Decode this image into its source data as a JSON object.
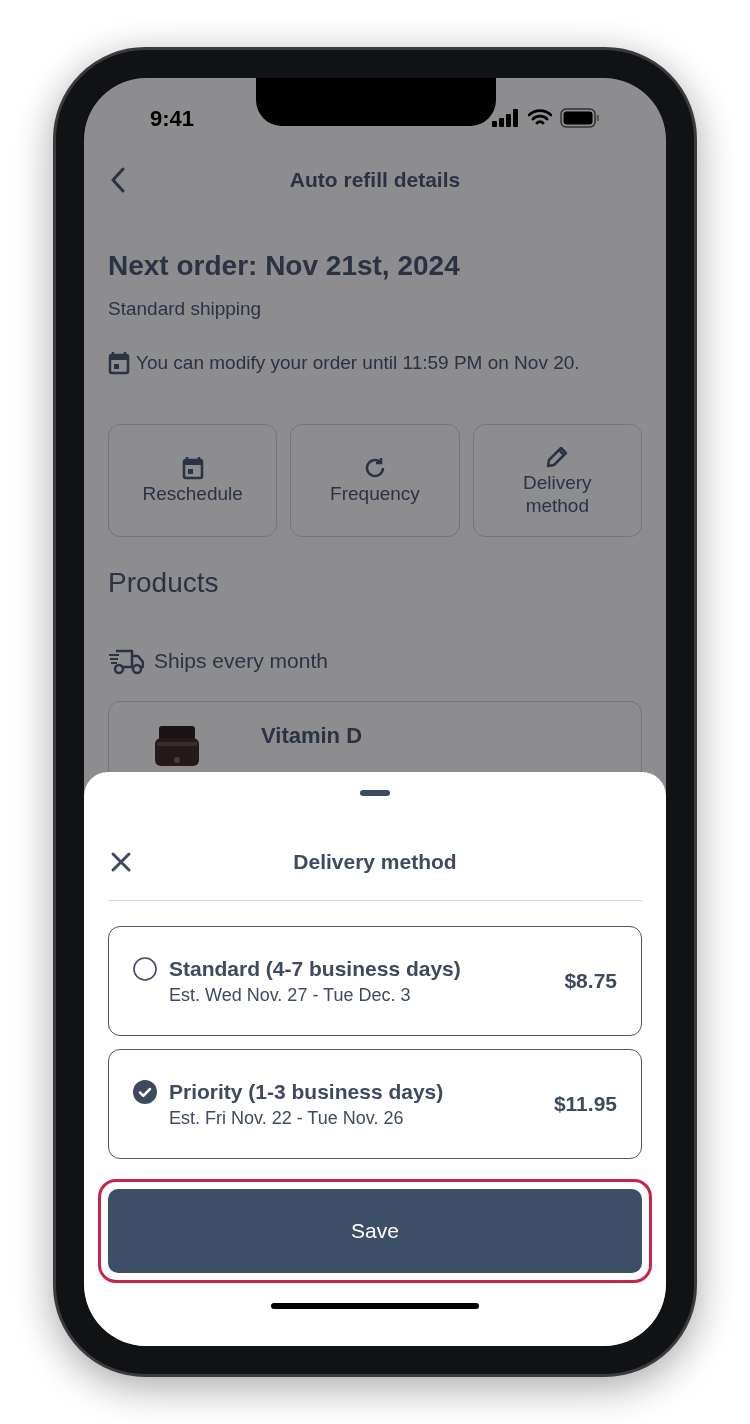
{
  "status_bar": {
    "time": "9:41"
  },
  "header": {
    "title": "Auto refill details"
  },
  "order": {
    "title": "Next order: Nov 21st, 2024",
    "shipping": "Standard shipping",
    "notice": "You can modify your order until 11:59 PM on Nov 20."
  },
  "actions": [
    {
      "label": "Reschedule",
      "kind": "calendar"
    },
    {
      "label": "Frequency",
      "kind": "refresh"
    },
    {
      "label": "Delivery method",
      "kind": "pencil"
    }
  ],
  "products": {
    "heading": "Products",
    "schedule": "Ships every month",
    "items": [
      {
        "name": "Vitamin D",
        "kind": "picture"
      }
    ]
  },
  "sheet": {
    "title": "Delivery method",
    "options": [
      {
        "label": "Standard (4-7 business days)",
        "eta": "Est. Wed Nov. 27 - Tue Dec. 3",
        "price": "$8.75",
        "selected": false
      },
      {
        "label": "Priority (1-3 business days)",
        "eta": "Est. Fri Nov. 22 - Tue Nov. 26",
        "price": "$11.95",
        "selected": true
      }
    ],
    "save_button": {
      "label": "Save",
      "focused": true
    }
  }
}
